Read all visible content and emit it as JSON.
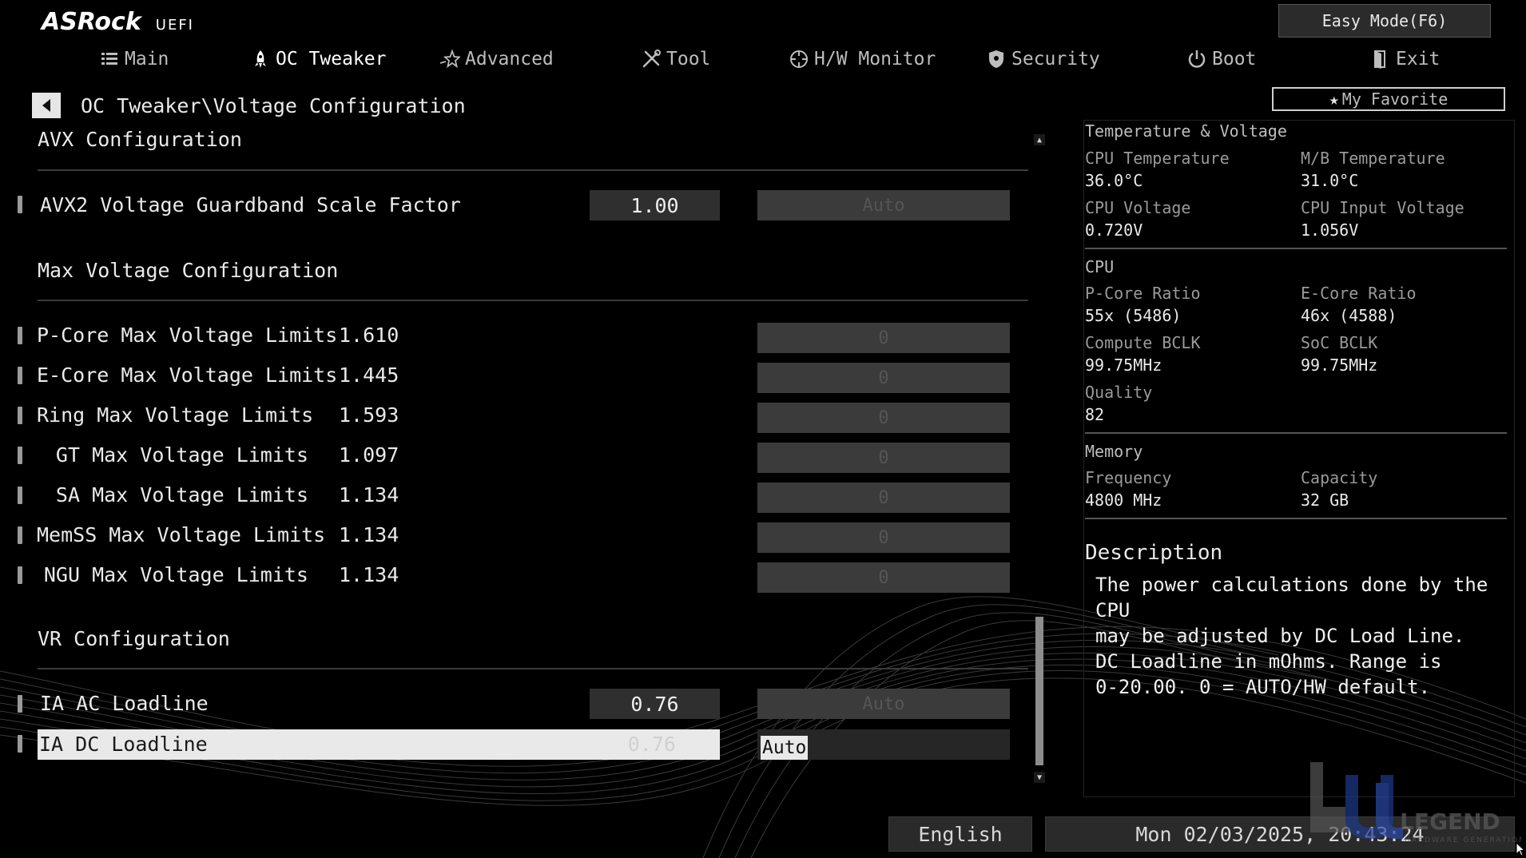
{
  "header": {
    "brand": "ASRock",
    "uefi": "UEFI",
    "easy_mode": "Easy Mode(F6)",
    "tabs": [
      {
        "label": "Main",
        "icon": "list-icon"
      },
      {
        "label": "OC Tweaker",
        "icon": "rocket-icon"
      },
      {
        "label": "Advanced",
        "icon": "star-icon"
      },
      {
        "label": "Tool",
        "icon": "tools-icon"
      },
      {
        "label": "H/W Monitor",
        "icon": "crosshair-icon"
      },
      {
        "label": "Security",
        "icon": "shield-icon"
      },
      {
        "label": "Boot",
        "icon": "power-icon"
      },
      {
        "label": "Exit",
        "icon": "exit-door-icon"
      }
    ],
    "active_tab": "OC Tweaker"
  },
  "breadcrumb": "OC Tweaker\\Voltage Configuration",
  "favorite": "My Favorite",
  "main": {
    "avx_section": "AVX Configuration",
    "avx_row": {
      "label": "AVX2 Voltage Guardband Scale Factor",
      "value": "1.00",
      "field": "Auto"
    },
    "max_section": "Max Voltage Configuration",
    "max_rows": [
      {
        "label": "P-Core Max Voltage Limits",
        "value": "1.610",
        "field": "0"
      },
      {
        "label": "E-Core Max Voltage Limits",
        "value": "1.445",
        "field": "0"
      },
      {
        "label": "Ring Max Voltage Limits",
        "value": "1.593",
        "field": "0"
      },
      {
        "label": "GT Max Voltage Limits",
        "value": "1.097",
        "field": "0"
      },
      {
        "label": "SA Max Voltage Limits",
        "value": "1.134",
        "field": "0"
      },
      {
        "label": "MemSS Max Voltage Limits",
        "value": "1.134",
        "field": "0"
      },
      {
        "label": "NGU Max Voltage Limits",
        "value": "1.134",
        "field": "0"
      }
    ],
    "vr_section": "VR Configuration",
    "ia_ac": {
      "label": "IA AC Loadline",
      "value": "0.76",
      "field": "Auto"
    },
    "ia_dc": {
      "label": "IA DC Loadline",
      "value": "0.76",
      "field": "Auto"
    }
  },
  "panel": {
    "temp_voltage_title": "Temperature & Voltage",
    "cpu_temp_label": "CPU Temperature",
    "cpu_temp_value": "36.0°C",
    "mb_temp_label": "M/B Temperature",
    "mb_temp_value": "31.0°C",
    "cpu_voltage_label": "CPU Voltage",
    "cpu_voltage_value": "0.720V",
    "cpu_input_voltage_label": "CPU Input Voltage",
    "cpu_input_voltage_value": "1.056V",
    "cpu_title": "CPU",
    "pcore_label": "P-Core Ratio",
    "pcore_value": "55x (5486)",
    "ecore_label": "E-Core Ratio",
    "ecore_value": "46x (4588)",
    "compute_bclk_label": "Compute BCLK",
    "compute_bclk_value": "99.75MHz",
    "soc_bclk_label": "SoC BCLK",
    "soc_bclk_value": "99.75MHz",
    "quality_label": "Quality",
    "quality_value": "82",
    "memory_title": "Memory",
    "frequency_label": "Frequency",
    "frequency_value": "4800 MHz",
    "capacity_label": "Capacity",
    "capacity_value": "32 GB",
    "description_title": "Description",
    "description_text": "The power calculations done by the CPU\nmay be adjusted by DC Load Line.\nDC Loadline in mOhms. Range is\n0-20.00. 0 = AUTO/HW default."
  },
  "footer": {
    "language": "English",
    "datetime": "Mon 02/03/2025, 20:43:24"
  },
  "watermark": {
    "text": "LEGEND",
    "sub": "HARDWARE GENERATION"
  },
  "colors": {
    "background": "#000000",
    "selected_row": "#e9e9e9",
    "field_bg": "#3b3b3b",
    "watermark_blue": "#1f3a8a"
  }
}
